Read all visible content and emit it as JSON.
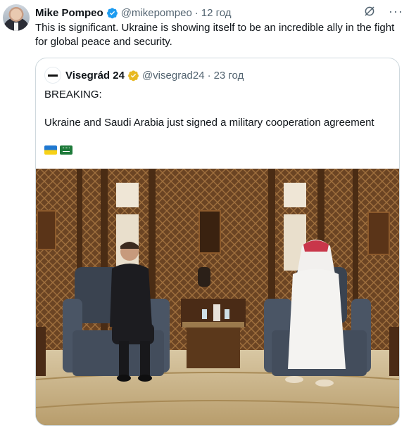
{
  "tweet": {
    "author_name": "Mike Pompeo",
    "handle": "@mikepompeo",
    "separator": "·",
    "time": "12 год",
    "text": "This is significant. Ukraine is showing itself to be an incredible ally in the fight for global peace and security.",
    "verified_color": "#1d9bf0",
    "more_label": "···"
  },
  "quote": {
    "author_name": "Visegrád 24",
    "handle": "@visegrad24",
    "separator": "·",
    "time": "23 год",
    "verified_color": "#e8b923",
    "text_line1": "BREAKING:",
    "text_line2": "Ukraine and Saudi Arabia just signed a military cooperation agreement",
    "flags": [
      "ukraine-flag",
      "saudi-arabia-flag"
    ]
  },
  "icons": {
    "verified": "verified-badge-icon",
    "grok": "grok-icon",
    "more": "more-icon"
  }
}
